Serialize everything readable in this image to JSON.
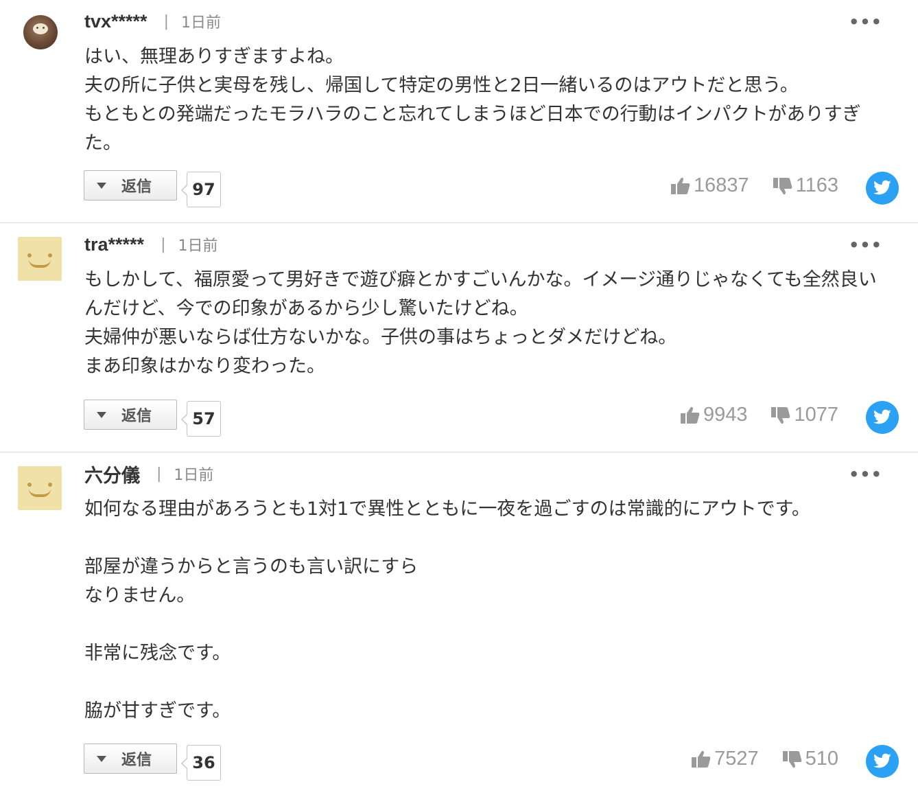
{
  "colors": {
    "twitter": "#2aa1f2",
    "vote_text": "#9a9a9a",
    "avatar_bg": "#efe1a8"
  },
  "comments": [
    {
      "username": "tvx*****",
      "separator": "|",
      "date": "1日前",
      "more_icon": "more-dots-icon",
      "body": "はい、無理ありすぎますよね。\n夫の所に子供と実母を残し、帰国して特定の男性と2日一緒いるのはアウトだと思う。\nもともとの発端だったモラハラのこと忘れてしまうほど日本での行動はインパクトがありすぎた。",
      "reply_label": "返信",
      "reply_count": "97",
      "likes": "16837",
      "dislikes": "1163"
    },
    {
      "username": "tra*****",
      "separator": "|",
      "date": "1日前",
      "more_icon": "more-dots-icon",
      "body": "もしかして、福原愛って男好きで遊び癖とかすごいんかな。イメージ通りじゃなくても全然良いんだけど、今での印象があるから少し驚いたけどね。\n夫婦仲が悪いならば仕方ないかな。子供の事はちょっとダメだけどね。\nまあ印象はかなり変わった。",
      "reply_label": "返信",
      "reply_count": "57",
      "likes": "9943",
      "dislikes": "1077"
    },
    {
      "username": "六分儀",
      "separator": "|",
      "date": "1日前",
      "more_icon": "more-dots-icon",
      "body": "如何なる理由があろうとも1対1で異性とともに一夜を過ごすのは常識的にアウトです。\n\n部屋が違うからと言うのも言い訳にすら\nなりません。\n\n非常に残念です。\n\n脇が甘すぎです。",
      "reply_label": "返信",
      "reply_count": "36",
      "likes": "7527",
      "dislikes": "510"
    }
  ]
}
